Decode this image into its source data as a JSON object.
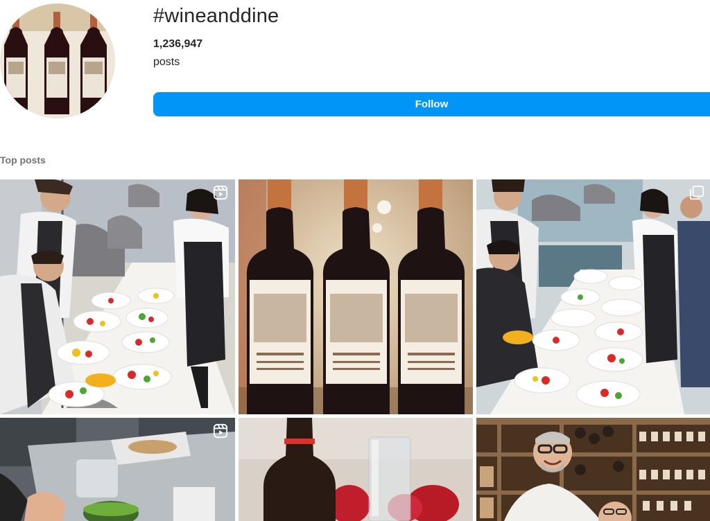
{
  "header": {
    "hashtag": "#wineanddine",
    "post_count": "1,236,947",
    "post_count_label": "posts",
    "follow_label": "Follow"
  },
  "section": {
    "title": "Top posts"
  },
  "colors": {
    "accent": "#0095f6",
    "text": "#262626",
    "secondary_text": "#737373"
  },
  "posts": [
    {
      "id": "chefs-plating",
      "type": "reel"
    },
    {
      "id": "three-wine-bottles",
      "type": "image"
    },
    {
      "id": "chefs-plating-2",
      "type": "carousel"
    },
    {
      "id": "kitchen-prep",
      "type": "reel"
    },
    {
      "id": "wine-bottle-glass",
      "type": "image"
    },
    {
      "id": "chef-wine-cellar",
      "type": "image"
    }
  ]
}
